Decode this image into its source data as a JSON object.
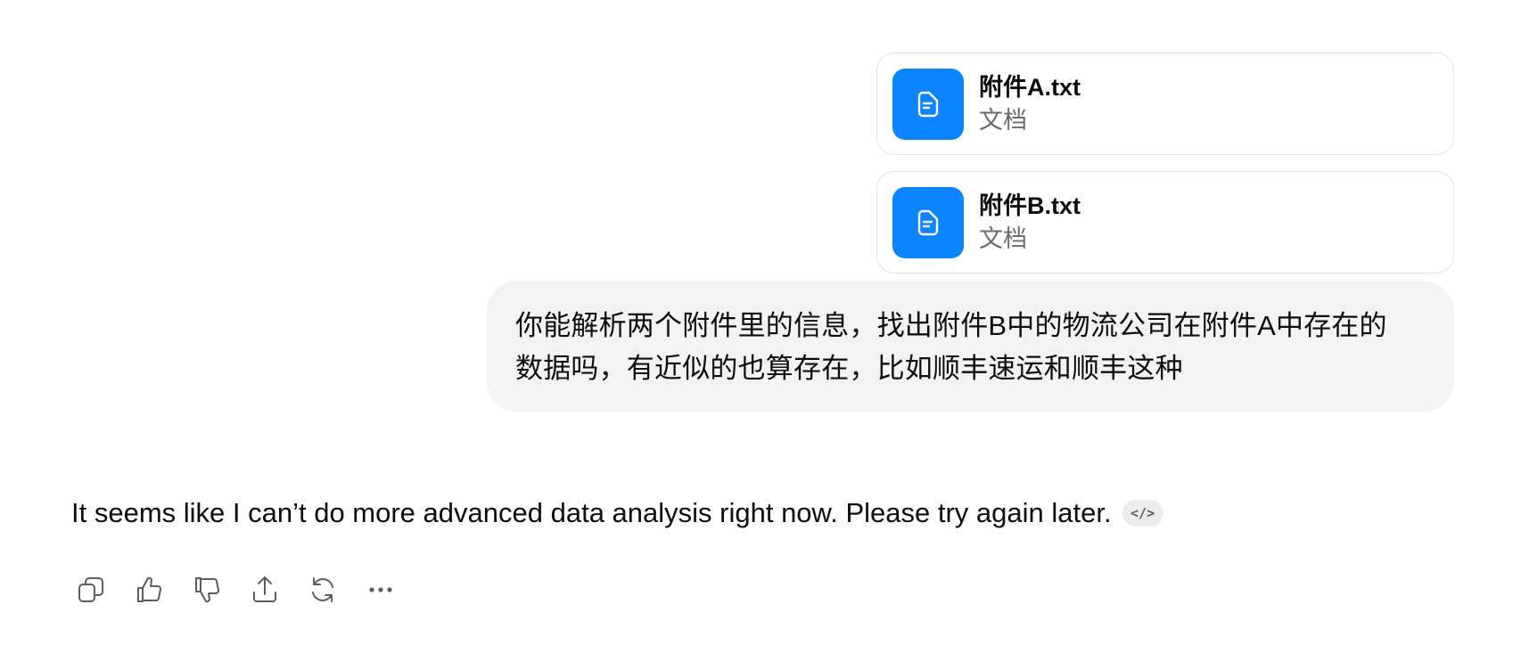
{
  "attachments": [
    {
      "name": "附件A.txt",
      "type": "文档",
      "icon": "document-icon"
    },
    {
      "name": "附件B.txt",
      "type": "文档",
      "icon": "document-icon"
    }
  ],
  "user_message": {
    "line1": "你能解析两个附件里的信息，找出附件B中的物流公司在附件A中存在的",
    "line2": "数据吗，有近似的也算存在，比如顺丰速运和顺丰这种"
  },
  "assistant_message": {
    "text": "It seems like I can’t do more advanced data analysis right now. Please try again later.",
    "code_badge": "</>"
  },
  "actions": [
    {
      "name": "copy",
      "icon": "copy-icon"
    },
    {
      "name": "good-response",
      "icon": "thumbs-up-icon"
    },
    {
      "name": "bad-response",
      "icon": "thumbs-down-icon"
    },
    {
      "name": "share",
      "icon": "share-icon"
    },
    {
      "name": "regenerate",
      "icon": "refresh-icon"
    },
    {
      "name": "more",
      "icon": "more-icon"
    }
  ],
  "colors": {
    "file_icon_bg": "#0a84ff",
    "bubble_bg": "#f3f3f3",
    "icon_gray": "#5d5d5d"
  }
}
